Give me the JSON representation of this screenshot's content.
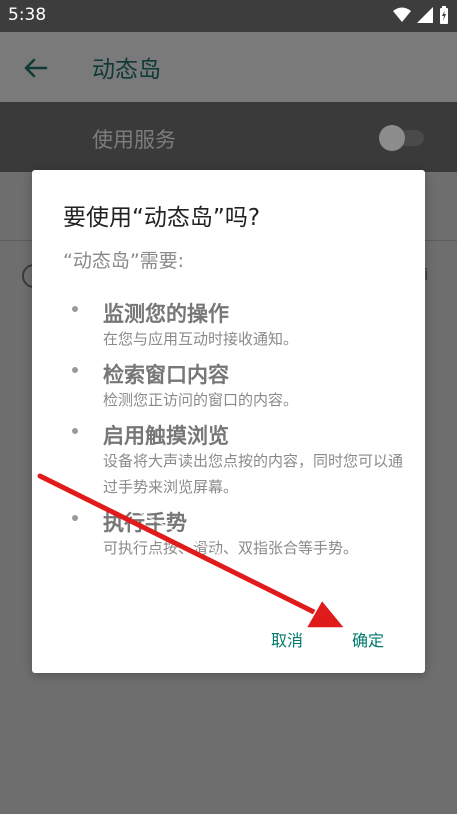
{
  "status_bar": {
    "time": "5:38",
    "icons": [
      "wifi-icon",
      "cellular-signal-icon",
      "battery-charging-icon"
    ]
  },
  "appbar": {
    "back_icon": "arrow-left-icon",
    "title": "动态岛"
  },
  "service": {
    "label": "使用服务",
    "enabled": false
  },
  "dialog": {
    "title": "要使用“动态岛”吗?",
    "subtitle": "“动态岛”需要:",
    "permissions": [
      {
        "title": "监测您的操作",
        "description": "在您与应用互动时接收通知。"
      },
      {
        "title": "检索窗口内容",
        "description": "检测您正访问的窗口的内容。"
      },
      {
        "title": "启用触摸浏览",
        "description": "设备将大声读出您点按的内容，同时您可以通过手势来浏览屏幕。"
      },
      {
        "title": "执行手势",
        "description": "可执行点按、滑动、双指张合等手势。"
      }
    ],
    "cancel_label": "取消",
    "confirm_label": "确定"
  },
  "colors": {
    "accent": "#00796b",
    "annotation_arrow": "#e01b1b",
    "scrim": "#6f6f6f"
  }
}
